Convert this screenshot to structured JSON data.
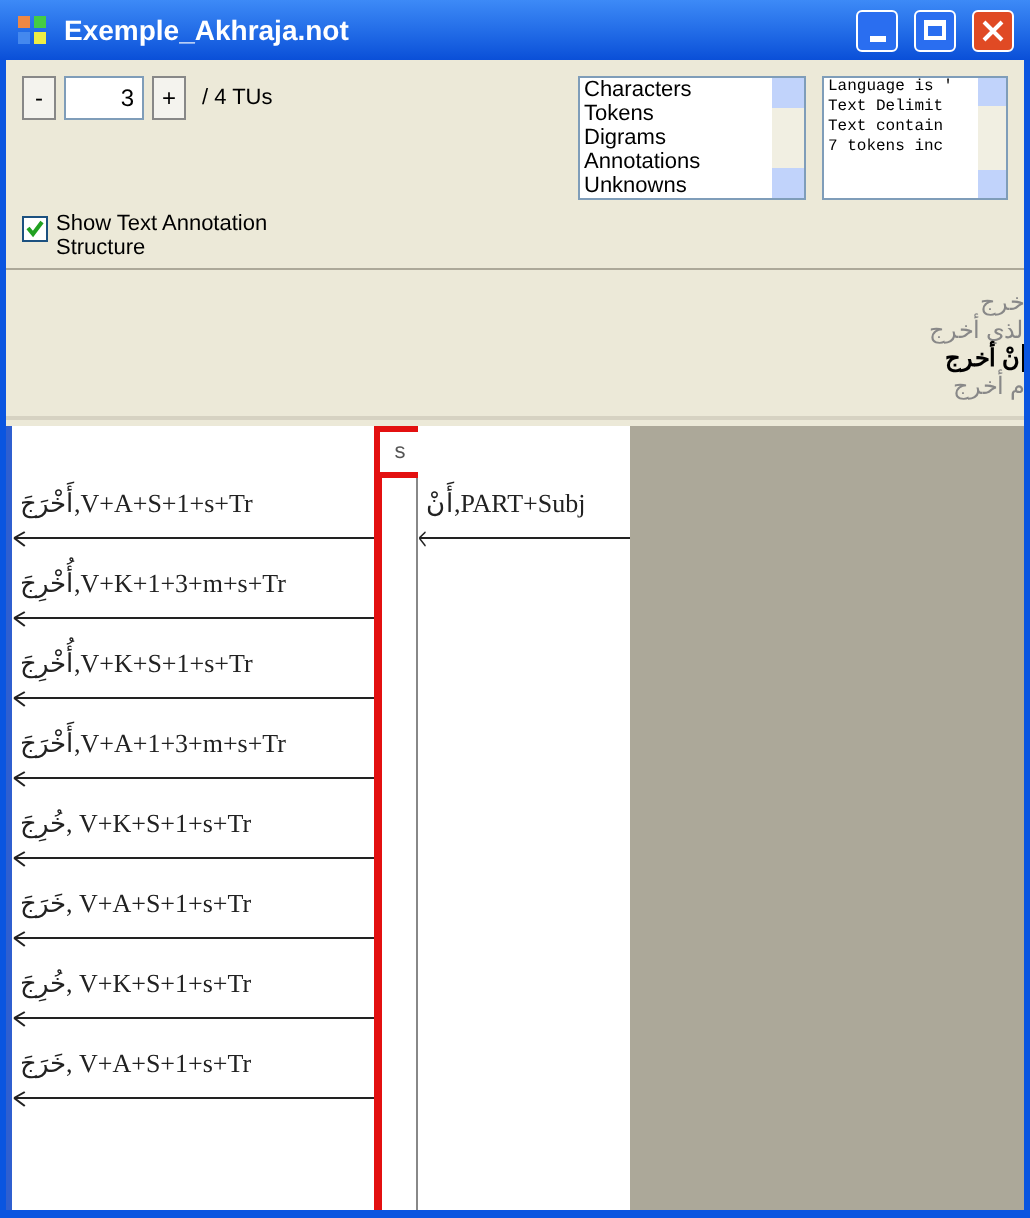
{
  "window": {
    "title": "Exemple_Akhraja.not"
  },
  "tu_nav": {
    "minus": "-",
    "value": "3",
    "plus": "+",
    "total": "/ 4 TUs"
  },
  "show_structure": {
    "label": "Show Text Annotation Structure",
    "checked": true
  },
  "views_list": {
    "items": [
      {
        "label": "Characters",
        "selected": false
      },
      {
        "label": "Tokens",
        "selected": false
      },
      {
        "label": "Digrams",
        "selected": false
      },
      {
        "label": "Annotations",
        "selected": false
      },
      {
        "label": "Unknowns",
        "selected": false
      }
    ]
  },
  "info_list": {
    "lines": [
      "Language is '",
      "Text Delimit",
      "Text contain",
      "7 tokens inc"
    ]
  },
  "text_lines": [
    {
      "text": "خرج",
      "current": false
    },
    {
      "text": "لذي أخرج",
      "current": false
    },
    {
      "text": "نْ أخرج",
      "current": true
    },
    {
      "text": "م أخرج",
      "current": false
    }
  ],
  "tu_marker": {
    "label": "s",
    "selected": true
  },
  "annotations_left": [
    "أَخْرَجَ,V+A+S+1+s+Tr",
    "أُخْرِجَ,V+K+1+3+m+s+Tr",
    "أُخْرِجَ,V+K+S+1+s+Tr",
    "أَخْرَجَ,V+A+1+3+m+s+Tr",
    "خُرِجَ, V+K+S+1+s+Tr",
    "خَرَجَ, V+A+S+1+s+Tr",
    "خُرِجَ, V+K+S+1+s+Tr",
    "خَرَجَ, V+A+S+1+s+Tr"
  ],
  "annotations_right": [
    "أَنْ,PART+Subj"
  ]
}
